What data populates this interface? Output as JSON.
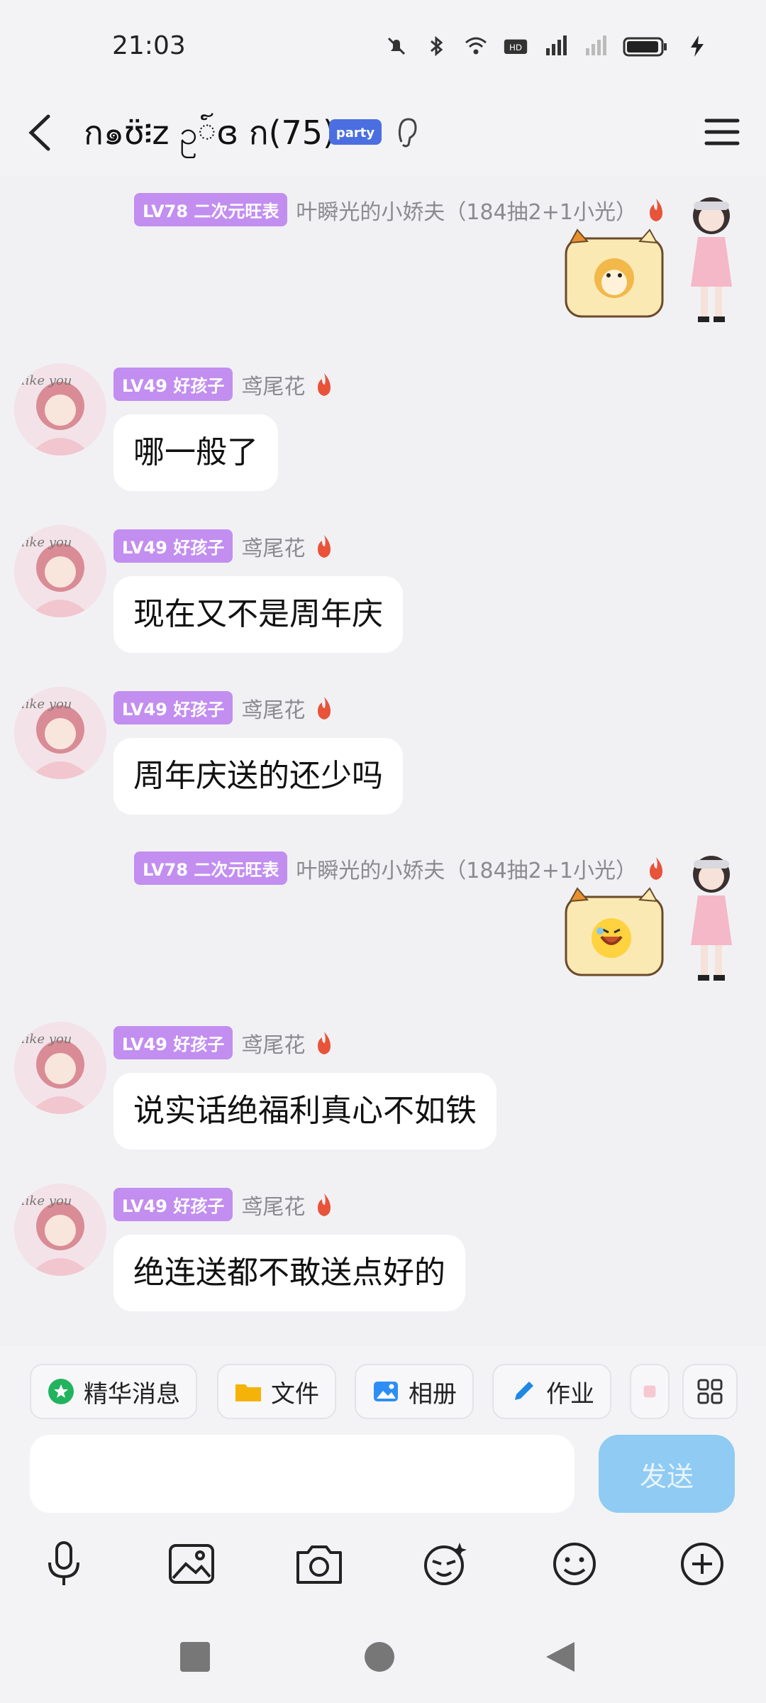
{
  "status": {
    "time": "21:03"
  },
  "header": {
    "title": "ก๑ʊ̈፧ᴢ ဥ៍ɞ ก(75)"
  },
  "messages": [
    {
      "side": "right",
      "level": "LV78 二次元旺表",
      "name": "叶瞬光的小娇夫（184抽2+1小光）",
      "sticker": "cat-doge-sticker"
    },
    {
      "side": "left",
      "level": "LV49 好孩子",
      "name": "鸢尾花",
      "text": "哪一般了"
    },
    {
      "side": "left",
      "level": "LV49 好孩子",
      "name": "鸢尾花",
      "text": "现在又不是周年庆"
    },
    {
      "side": "left",
      "level": "LV49 好孩子",
      "name": "鸢尾花",
      "text": "周年庆送的还少吗"
    },
    {
      "side": "right",
      "level": "LV78 二次元旺表",
      "name": "叶瞬光的小娇夫（184抽2+1小光）",
      "sticker": "cat-laugh-sticker"
    },
    {
      "side": "left",
      "level": "LV49 好孩子",
      "name": "鸢尾花",
      "text": "说实话绝福利真心不如铁"
    },
    {
      "side": "left",
      "level": "LV49 好孩子",
      "name": "鸢尾花",
      "text": "绝连送都不敢送点好的"
    }
  ],
  "toolbar": {
    "chips": [
      "精华消息",
      "文件",
      "相册",
      "作业"
    ]
  },
  "input": {
    "send_label": "发送"
  },
  "colors": {
    "level_badge": "#c28ef0",
    "send_button": "#8fcbf3",
    "flame": "#e8533a"
  }
}
